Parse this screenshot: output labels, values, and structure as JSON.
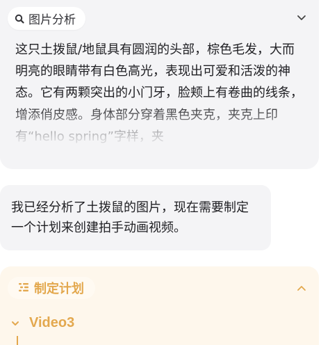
{
  "analysis": {
    "title": "图片分析",
    "icon": "search-icon",
    "collapse_icon": "chevron-down-icon",
    "text": "这只土拨鼠/地鼠具有圆润的头部，棕色毛发，大而明亮的眼睛带有白色高光，表现出可爱和活泼的神态。它有两颗突出的小门牙，脸颊上有卷曲的线条，增添俏皮感。身体部分穿着黑色夹克，夹克上印有“hello spring”字样，夹"
  },
  "message": {
    "text": "我已经分析了土拨鼠的图片，现在需要制定一个计划来创建拍手动画视频。"
  },
  "plan": {
    "title": "制定计划",
    "icon": "list-icon",
    "collapse_icon": "chevron-up-icon",
    "items": [
      {
        "label": "Video3",
        "icon": "chevron-down-icon"
      }
    ]
  },
  "colors": {
    "card_bg": "#f4f4f6",
    "plan_bg": "#fef7ec",
    "accent": "#e3a84e",
    "text": "#202024"
  }
}
